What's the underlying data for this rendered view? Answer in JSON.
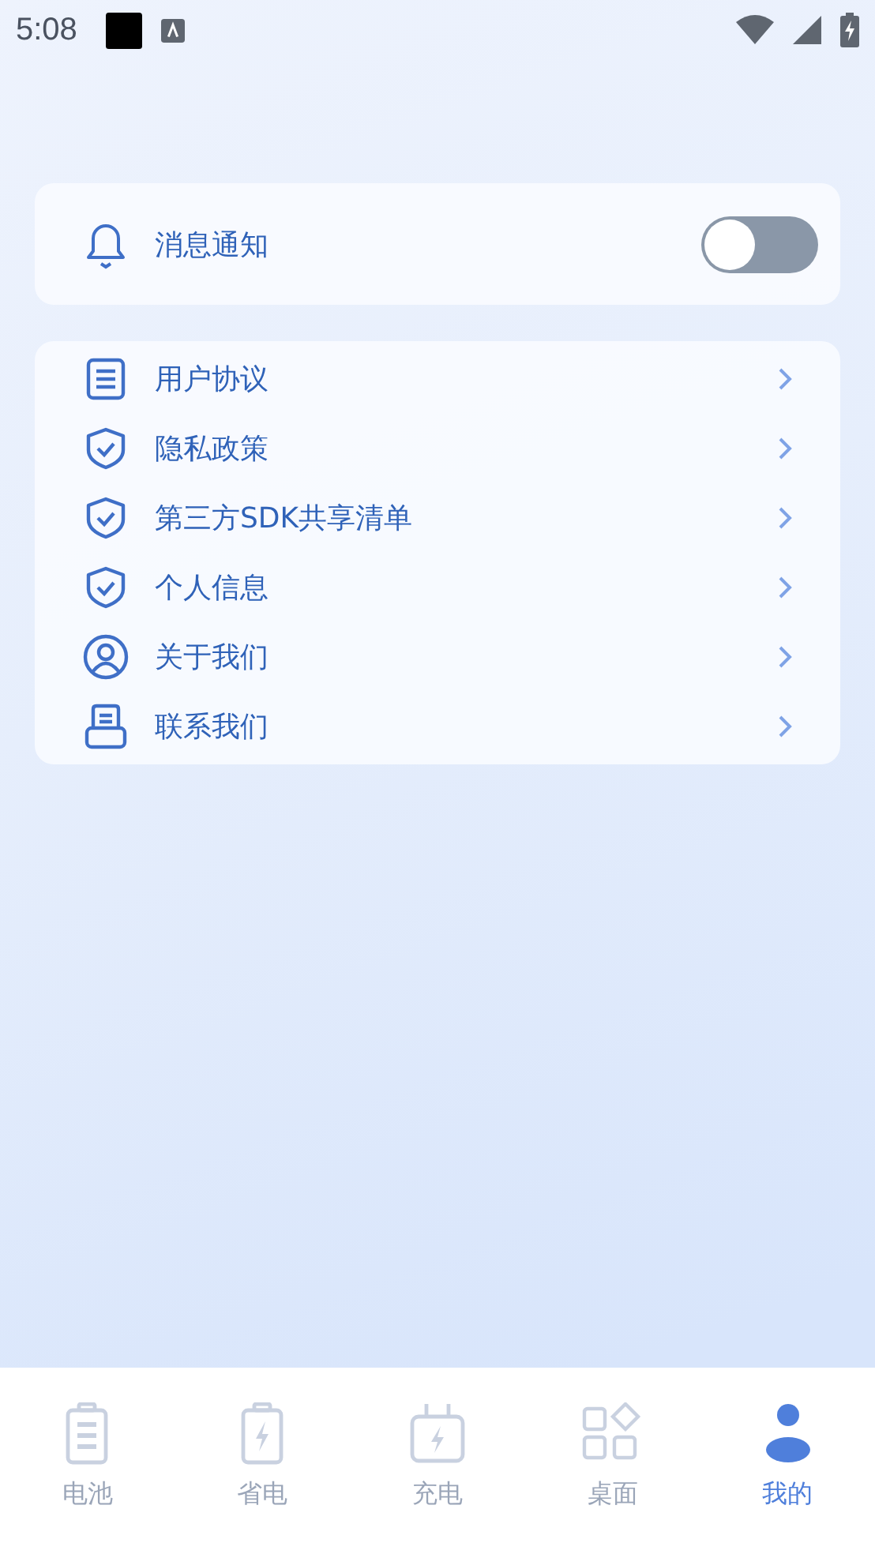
{
  "status_bar": {
    "time": "5:08"
  },
  "notification": {
    "label": "消息通知",
    "on": false
  },
  "menu": [
    {
      "label": "用户协议",
      "kind": "document"
    },
    {
      "label": "隐私政策",
      "kind": "shield"
    },
    {
      "label": "第三方SDK共享清单",
      "kind": "shield"
    },
    {
      "label": "个人信息",
      "kind": "shield"
    },
    {
      "label": "关于我们",
      "kind": "person"
    },
    {
      "label": "联系我们",
      "kind": "contact"
    }
  ],
  "tabs": [
    {
      "label": "电池",
      "kind": "battery",
      "selected": false
    },
    {
      "label": "省电",
      "kind": "saver",
      "selected": false
    },
    {
      "label": "充电",
      "kind": "charge",
      "selected": false
    },
    {
      "label": "桌面",
      "kind": "grid",
      "selected": false
    },
    {
      "label": "我的",
      "kind": "me",
      "selected": true
    }
  ]
}
